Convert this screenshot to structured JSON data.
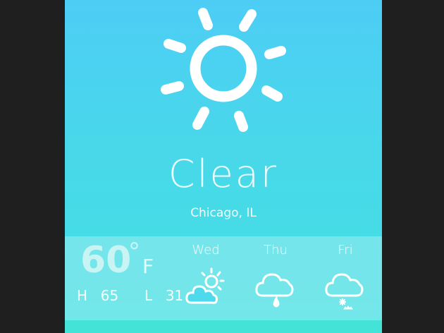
{
  "weather": {
    "condition": "Clear",
    "location": "Chicago, IL",
    "condition_icon": "sun-icon"
  },
  "current": {
    "temperature": "60",
    "degree_symbol": "°",
    "unit": "F",
    "high_label": "H",
    "high": "65",
    "low_label": "L",
    "low": "31"
  },
  "forecast": [
    {
      "day": "Wed",
      "icon": "partly-cloudy-icon"
    },
    {
      "day": "Thu",
      "icon": "rain-icon"
    },
    {
      "day": "Fri",
      "icon": "snow-icon"
    }
  ],
  "colors": {
    "background": "#1f1f1f",
    "gradient_top": "#4dcdf5",
    "gradient_bottom": "#42e0e1",
    "text": "#ffffff"
  }
}
